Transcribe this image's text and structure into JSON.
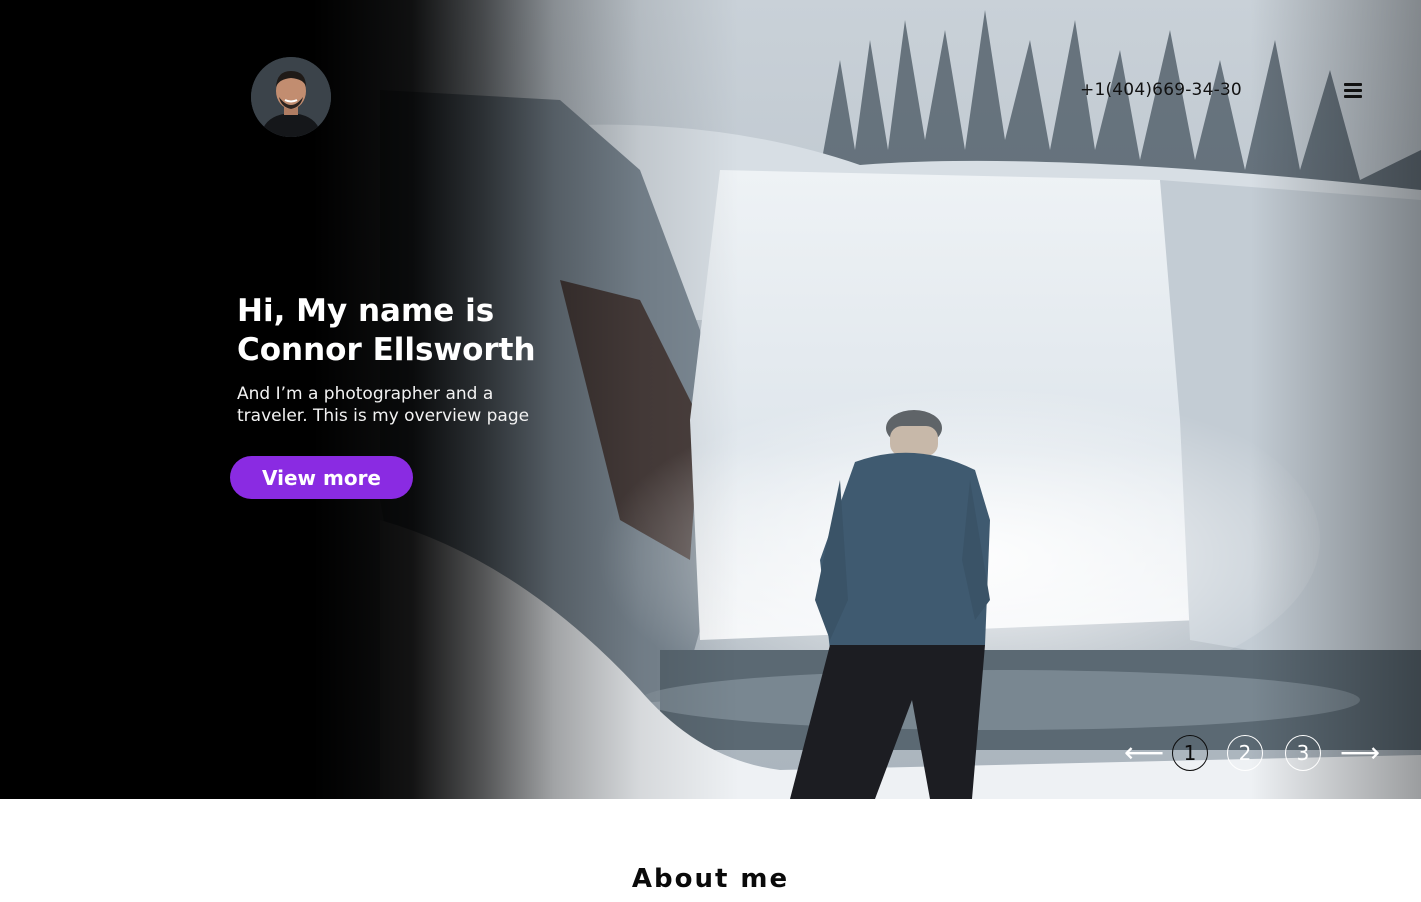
{
  "header": {
    "phone": "+1(404)669-34-30",
    "menu_icon": "hamburger-menu-icon"
  },
  "hero": {
    "title_lines": [
      "Hi, My name is",
      "Connor Ellsworth"
    ],
    "subtitle_lines": [
      "And I’m a photographer and a",
      "traveler. This is my overview page"
    ],
    "cta_label": "View more",
    "accent_color": "#8a2be2"
  },
  "pager": {
    "prev_icon": "arrow-left-icon",
    "next_icon": "arrow-right-icon",
    "prev_glyph": "⟵",
    "next_glyph": "⟶",
    "pages": [
      "1",
      "2",
      "3"
    ],
    "active_page": "1"
  },
  "about": {
    "title": "About me"
  }
}
